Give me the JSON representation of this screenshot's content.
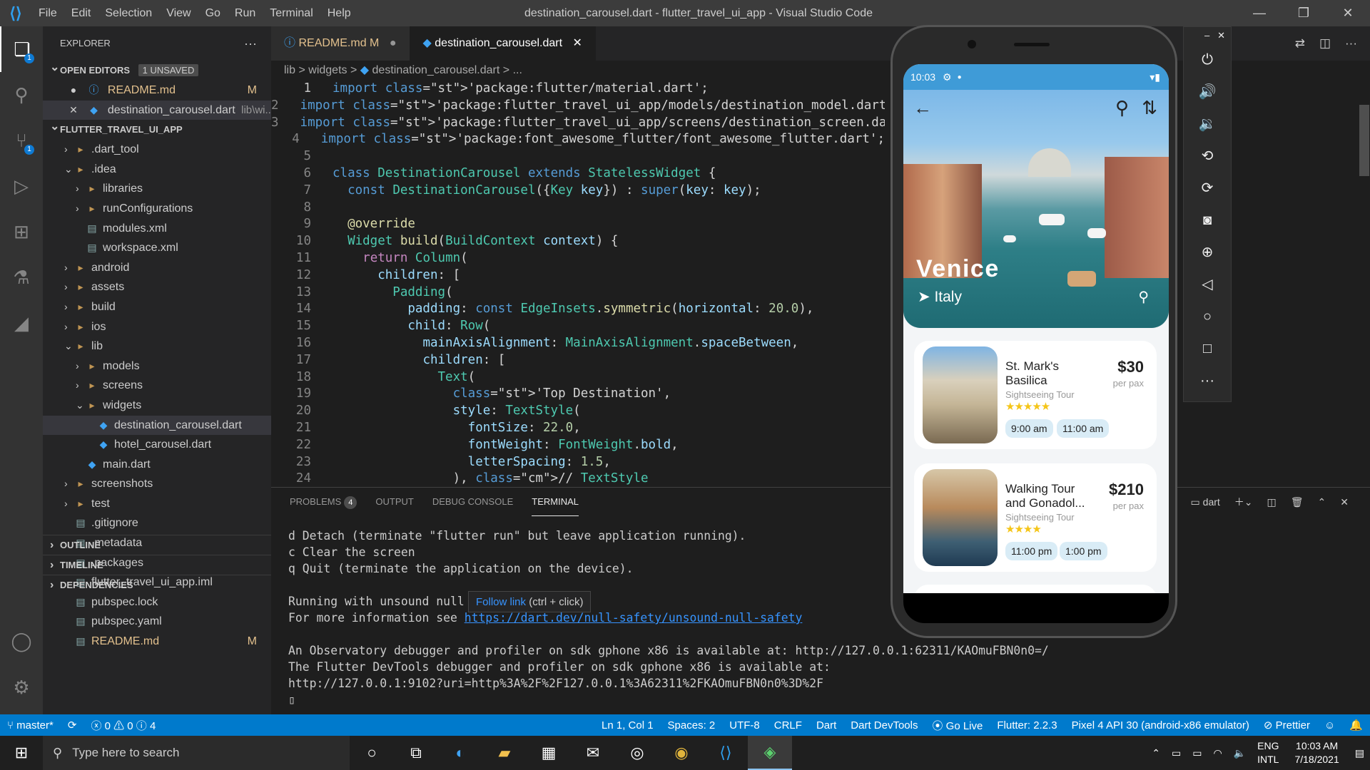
{
  "window": {
    "title": "destination_carousel.dart - flutter_travel_ui_app - Visual Studio Code",
    "menu": [
      "File",
      "Edit",
      "Selection",
      "View",
      "Go",
      "Run",
      "Terminal",
      "Help"
    ]
  },
  "activity": {
    "explorer_badge": "1",
    "scm_badge": "1"
  },
  "explorer": {
    "title": "EXPLORER",
    "open_editors": "OPEN EDITORS",
    "unsaved": "1 UNSAVED",
    "open_files": [
      {
        "name": "README.md",
        "status": "M"
      },
      {
        "name": "destination_carousel.dart",
        "path": "lib\\wi..."
      }
    ],
    "project": "FLUTTER_TRAVEL_UI_APP",
    "tree": [
      {
        "label": ".dart_tool",
        "depth": 1,
        "type": "folder",
        "chev": "›"
      },
      {
        "label": ".idea",
        "depth": 1,
        "type": "folder",
        "chev": "⌄"
      },
      {
        "label": "libraries",
        "depth": 2,
        "type": "folder",
        "chev": "›"
      },
      {
        "label": "runConfigurations",
        "depth": 2,
        "type": "folder",
        "chev": "›"
      },
      {
        "label": "modules.xml",
        "depth": 2,
        "type": "file"
      },
      {
        "label": "workspace.xml",
        "depth": 2,
        "type": "file"
      },
      {
        "label": "android",
        "depth": 1,
        "type": "folder",
        "chev": "›"
      },
      {
        "label": "assets",
        "depth": 1,
        "type": "folder",
        "chev": "›"
      },
      {
        "label": "build",
        "depth": 1,
        "type": "folder",
        "chev": "›"
      },
      {
        "label": "ios",
        "depth": 1,
        "type": "folder",
        "chev": "›"
      },
      {
        "label": "lib",
        "depth": 1,
        "type": "folder",
        "chev": "⌄"
      },
      {
        "label": "models",
        "depth": 2,
        "type": "folder",
        "chev": "›"
      },
      {
        "label": "screens",
        "depth": 2,
        "type": "folder",
        "chev": "›"
      },
      {
        "label": "widgets",
        "depth": 2,
        "type": "folder",
        "chev": "⌄"
      },
      {
        "label": "destination_carousel.dart",
        "depth": 3,
        "type": "dart",
        "selected": true
      },
      {
        "label": "hotel_carousel.dart",
        "depth": 3,
        "type": "dart"
      },
      {
        "label": "main.dart",
        "depth": 2,
        "type": "dart"
      },
      {
        "label": "screenshots",
        "depth": 1,
        "type": "folder",
        "chev": "›"
      },
      {
        "label": "test",
        "depth": 1,
        "type": "folder",
        "chev": "›"
      },
      {
        "label": ".gitignore",
        "depth": 1,
        "type": "file"
      },
      {
        "label": ".metadata",
        "depth": 1,
        "type": "file"
      },
      {
        "label": ".packages",
        "depth": 1,
        "type": "file"
      },
      {
        "label": "flutter_travel_ui_app.iml",
        "depth": 1,
        "type": "file"
      },
      {
        "label": "pubspec.lock",
        "depth": 1,
        "type": "file"
      },
      {
        "label": "pubspec.yaml",
        "depth": 1,
        "type": "file"
      },
      {
        "label": "README.md",
        "depth": 1,
        "type": "file",
        "status": "M"
      }
    ],
    "bottom_sections": [
      "OUTLINE",
      "TIMELINE",
      "DEPENDENCIES"
    ]
  },
  "tabs": [
    {
      "label": "README.md",
      "mod": "M"
    },
    {
      "label": "destination_carousel.dart"
    }
  ],
  "breadcrumbs": [
    "lib",
    ">",
    "widgets",
    ">",
    "destination_carousel.dart",
    ">",
    "..."
  ],
  "code_lines": [
    "import 'package:flutter/material.dart';",
    "import 'package:flutter_travel_ui_app/models/destination_model.dart';",
    "import 'package:flutter_travel_ui_app/screens/destination_screen.dart';",
    "import 'package:font_awesome_flutter/font_awesome_flutter.dart';",
    "",
    "class DestinationCarousel extends StatelessWidget {",
    "  const DestinationCarousel({Key key}) : super(key: key);",
    "",
    "  @override",
    "  Widget build(BuildContext context) {",
    "    return Column(",
    "      children: [",
    "        Padding(",
    "          padding: const EdgeInsets.symmetric(horizontal: 20.0),",
    "          child: Row(",
    "            mainAxisAlignment: MainAxisAlignment.spaceBetween,",
    "            children: [",
    "              Text(",
    "                'Top Destination',",
    "                style: TextStyle(",
    "                  fontSize: 22.0,",
    "                  fontWeight: FontWeight.bold,",
    "                  letterSpacing: 1.5,",
    "                ), // TextStyle"
  ],
  "panel": {
    "tabs": [
      "PROBLEMS",
      "OUTPUT",
      "DEBUG CONSOLE",
      "TERMINAL"
    ],
    "problems_count": "4",
    "terminal_name": "dart",
    "lines": [
      "d Detach (terminate \"flutter run\" but leave application running).",
      "c Clear the screen",
      "q Quit (terminate the application on the device).",
      "",
      "Running with unsound null safety",
      "For more information see ",
      "",
      "An Observatory debugger and profiler on sdk gphone x86 is available at: http://127.0.0.1:62311/KAOmuFBN0n0=/",
      "The Flutter DevTools debugger and profiler on sdk gphone x86 is available at:",
      "http://127.0.0.1:9102?uri=http%3A%2F%2F127.0.0.1%3A62311%2FKAOmuFBN0n0%3D%2F"
    ],
    "link": "https://dart.dev/null-safety/unsound-null-safety",
    "tooltip_link": "Follow link",
    "tooltip_hint": "(ctrl + click)"
  },
  "statusbar": {
    "branch": "master*",
    "errors": "0",
    "warnings": "0",
    "infos": "4",
    "position": "Ln 1, Col 1",
    "spaces": "Spaces: 2",
    "encoding": "UTF-8",
    "eol": "CRLF",
    "language": "Dart",
    "devtools": "Dart DevTools",
    "golive": "Go Live",
    "flutter": "Flutter: 2.2.3",
    "device": "Pixel 4 API 30 (android-x86 emulator)",
    "prettier": "Prettier"
  },
  "phone": {
    "time": "10:03",
    "city": "Venice",
    "country": "Italy",
    "cards": [
      {
        "name": "St. Mark's Basilica",
        "type": "Sightseeing Tour",
        "price": "$30",
        "pax": "per pax",
        "times": [
          "9:00 am",
          "11:00 am"
        ],
        "stars": "★★★★★"
      },
      {
        "name": "Walking Tour and Gonadol...",
        "type": "Sightseeing Tour",
        "price": "$210",
        "pax": "per pax",
        "times": [
          "11:00 pm",
          "1:00 pm"
        ],
        "stars": "★★★★"
      }
    ]
  },
  "taskbar": {
    "search_placeholder": "Type here to search",
    "lang1": "ENG",
    "lang2": "INTL",
    "time": "10:03 AM",
    "date": "7/18/2021"
  }
}
